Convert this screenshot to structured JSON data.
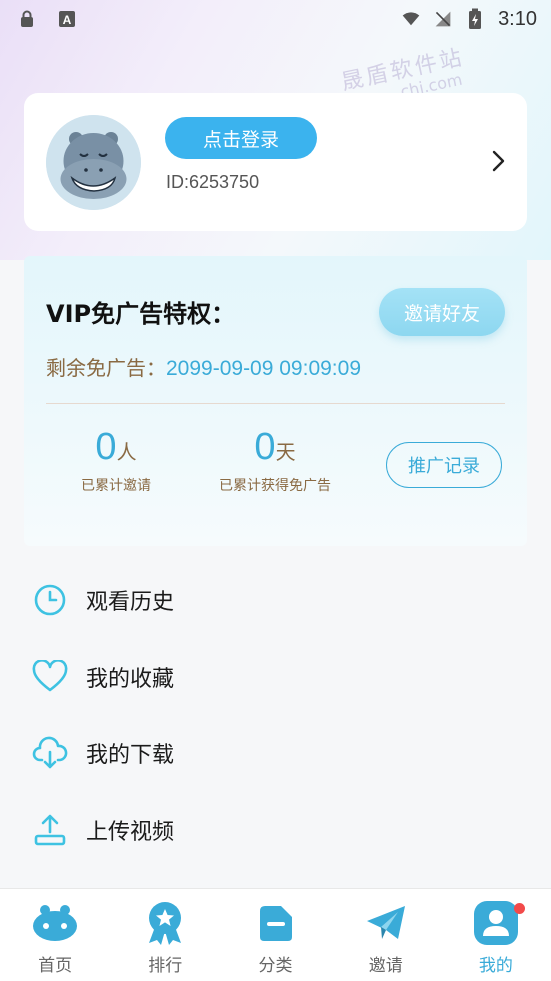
{
  "status_bar": {
    "time": "3:10"
  },
  "watermark": {
    "line1": "晟盾软件站",
    "line2": "chi.com"
  },
  "profile": {
    "login_label": "点击登录",
    "user_id": "ID:6253750"
  },
  "vip": {
    "title": "VIP免广告特权：",
    "invite_label": "邀请好友",
    "remain_label": "剩余免广告：",
    "remain_value": "2099-09-09 09:09:09",
    "invited_count": "0",
    "invited_unit": "人",
    "invited_label": "已累计邀请",
    "days_count": "0",
    "days_unit": "天",
    "days_label": "已累计获得免广告",
    "promo_label": "推广记录"
  },
  "menu": [
    {
      "label": "观看历史",
      "icon": "clock-icon"
    },
    {
      "label": "我的收藏",
      "icon": "heart-icon"
    },
    {
      "label": "我的下载",
      "icon": "cloud-download-icon"
    },
    {
      "label": "上传视频",
      "icon": "upload-icon"
    }
  ],
  "tabs": [
    {
      "label": "首页",
      "icon": "hippo-home-icon"
    },
    {
      "label": "排行",
      "icon": "ranking-badge-icon"
    },
    {
      "label": "分类",
      "icon": "category-icon"
    },
    {
      "label": "邀请",
      "icon": "paper-plane-icon"
    },
    {
      "label": "我的",
      "icon": "profile-icon",
      "active": true
    }
  ],
  "colors": {
    "accent": "#3aabd8",
    "login_button": "#3bb3ee",
    "label_brown": "#8a6a43",
    "notification_dot": "#f24a4a"
  }
}
